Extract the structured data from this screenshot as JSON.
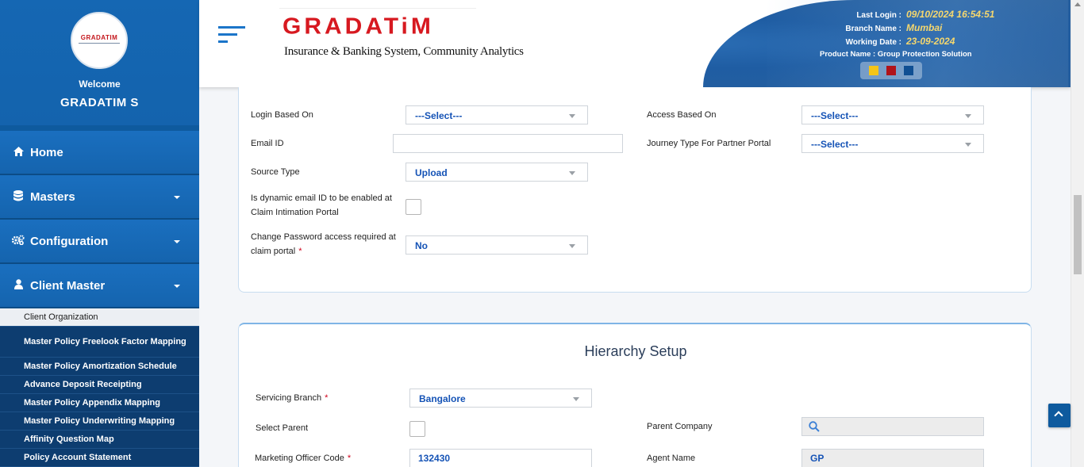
{
  "sidebar": {
    "welcome": "Welcome",
    "username": "GRADATIM S",
    "avatar_logo": "GRADATIM",
    "nav": [
      {
        "label": "Home",
        "icon": "home-icon"
      },
      {
        "label": "Masters",
        "icon": "database-icon"
      },
      {
        "label": "Configuration",
        "icon": "cogs-icon"
      },
      {
        "label": "Client Master",
        "icon": "user-icon"
      }
    ],
    "submenu": [
      "Client Organization",
      "Master Policy Freelook Factor Mapping",
      "Master Policy Amortization Schedule",
      "Advance Deposit Receipting",
      "Master Policy Appendix Mapping",
      "Master Policy Underwriting Mapping",
      "Affinity Question Map",
      "Policy Account Statement"
    ]
  },
  "header": {
    "brand_name": "GRADATiM",
    "brand_tagline": "Insurance & Banking System, Community Analytics",
    "last_login_label": "Last Login :",
    "last_login_value": "09/10/2024 16:54:51",
    "branch_label": "Branch Name :",
    "branch_value": "Mumbai",
    "working_date_label": "Working Date :",
    "working_date_value": "23-09-2024",
    "product_name": "Product Name : Group Protection Solution",
    "theme_colors": [
      "#f5c518",
      "#b0131a",
      "#0f4f93"
    ]
  },
  "form": {
    "login_based_on_label": "Login Based On",
    "login_based_on_value": "---Select---",
    "access_based_on_label": "Access Based On",
    "access_based_on_value": "---Select---",
    "email_id_label": "Email ID",
    "email_id_value": "",
    "journey_type_label": "Journey Type For Partner Portal",
    "journey_type_value": "---Select---",
    "source_type_label": "Source Type",
    "source_type_value": "Upload",
    "dynamic_email_label": "Is dynamic email ID to be enabled at Claim Intimation Portal",
    "change_password_label": "Change Password access required at claim portal",
    "change_password_value": "No"
  },
  "hierarchy": {
    "title": "Hierarchy Setup",
    "servicing_branch_label": "Servicing Branch",
    "servicing_branch_value": "Bangalore",
    "parent_company_label": "Parent Company",
    "parent_company_value": "",
    "select_parent_label": "Select Parent",
    "marketing_officer_label": "Marketing Officer Code",
    "marketing_officer_value": "132430",
    "agent_name_label": "Agent Name",
    "agent_name_value": "GP"
  }
}
